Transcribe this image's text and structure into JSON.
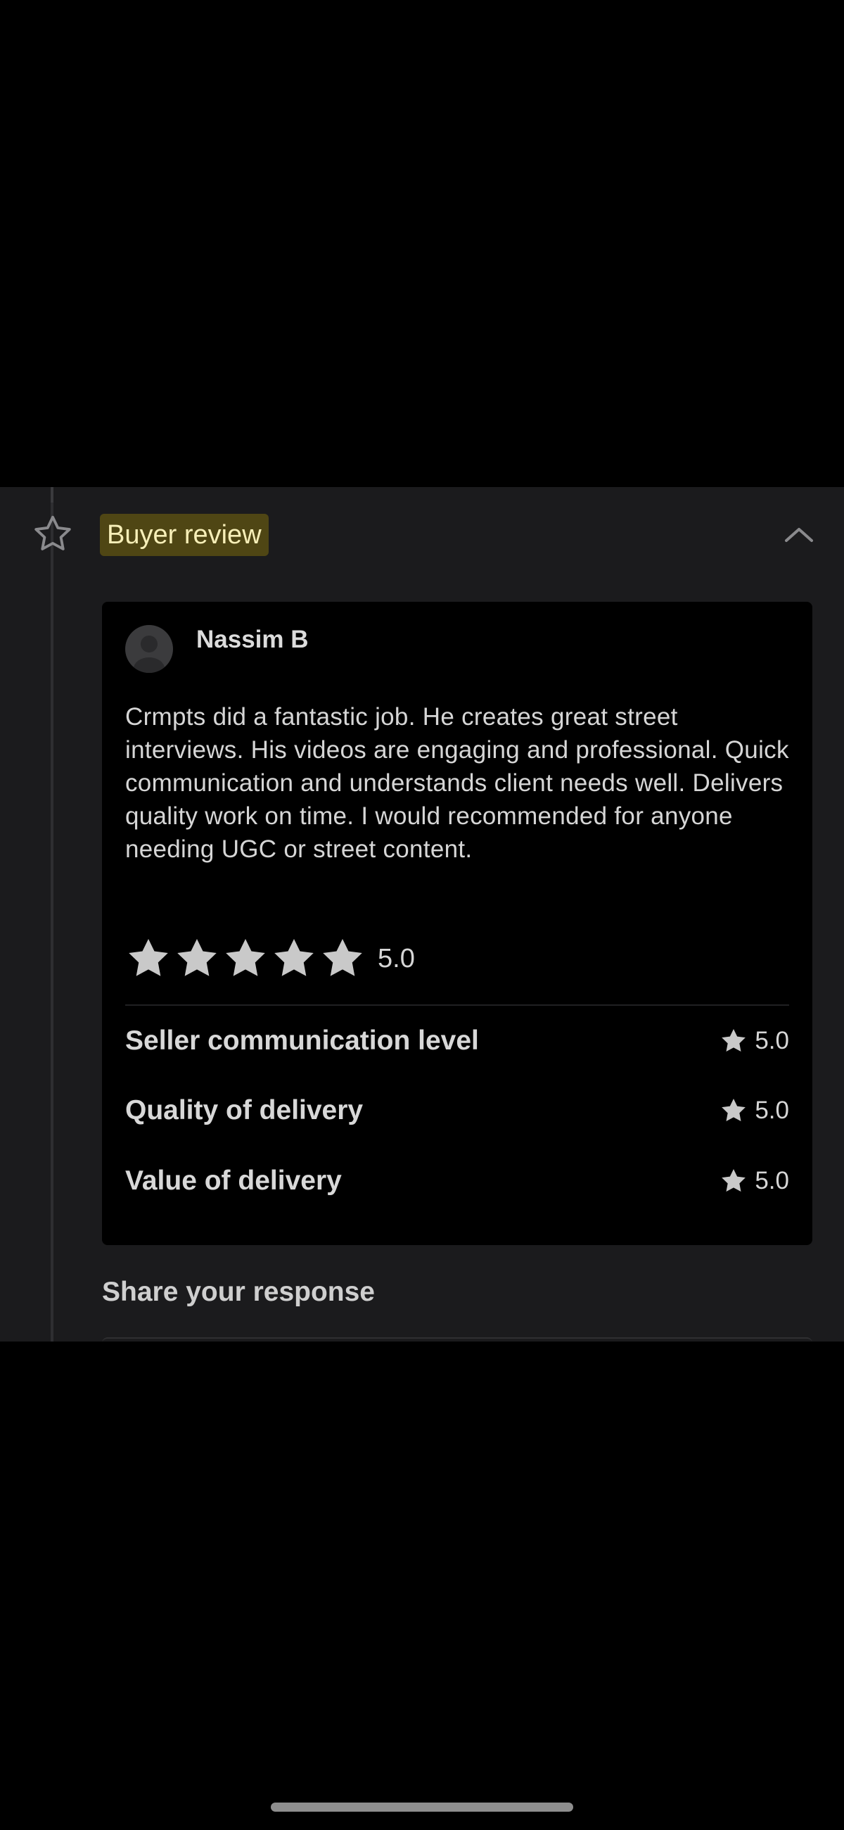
{
  "section": {
    "title": "Buyer review",
    "icon": "star-outline-icon",
    "collapse_icon": "chevron-up-icon",
    "accent_badge_bg": "#4f4614",
    "accent_badge_text": "#f7efb8"
  },
  "review": {
    "reviewer_name": "Nassim B",
    "avatar_icon": "user-avatar-icon",
    "text": "Crmpts did a fantastic job. He creates great street interviews. His videos are engaging and professional. Quick communication and understands client needs well. Delivers quality work on time. I would recommended for anyone needing UGC or street content.",
    "rating_stars": 5,
    "overall_rating": "5.0",
    "metrics": [
      {
        "label": "Seller communication level",
        "value": "5.0"
      },
      {
        "label": "Quality of delivery",
        "value": "5.0"
      },
      {
        "label": "Value of delivery",
        "value": "5.0"
      }
    ]
  },
  "response": {
    "heading": "Share your response"
  }
}
